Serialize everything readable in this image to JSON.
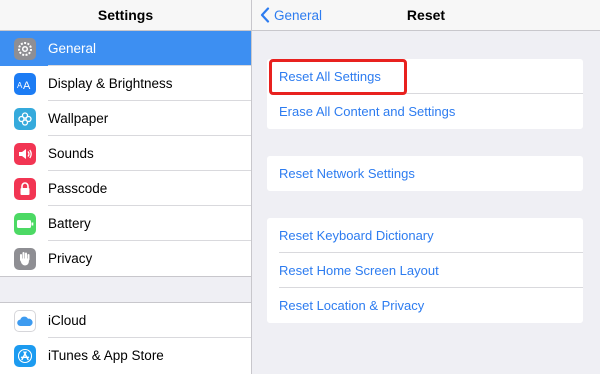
{
  "sidebar": {
    "title": "Settings",
    "items": [
      {
        "label": "General",
        "icon": "gear-icon",
        "color": "#8e8e93"
      },
      {
        "label": "Display & Brightness",
        "icon": "text-size-icon",
        "color": "#1c7cf4"
      },
      {
        "label": "Wallpaper",
        "icon": "flower-icon",
        "color": "#35aadc"
      },
      {
        "label": "Sounds",
        "icon": "speaker-icon",
        "color": "#f23553"
      },
      {
        "label": "Passcode",
        "icon": "lock-icon",
        "color": "#f23553"
      },
      {
        "label": "Battery",
        "icon": "battery-icon",
        "color": "#4cd964"
      },
      {
        "label": "Privacy",
        "icon": "hand-icon",
        "color": "#8e8e93"
      },
      {
        "label": "iCloud",
        "icon": "cloud-icon",
        "color": "#ffffff"
      },
      {
        "label": "iTunes & App Store",
        "icon": "app-store-icon",
        "color": "#1c9bf0"
      }
    ]
  },
  "detail": {
    "back_label": "General",
    "title": "Reset",
    "groups": [
      [
        "Reset All Settings",
        "Erase All Content and Settings"
      ],
      [
        "Reset Network Settings"
      ],
      [
        "Reset Keyboard Dictionary",
        "Reset Home Screen Layout",
        "Reset Location & Privacy"
      ]
    ]
  },
  "colors": {
    "accent": "#2d7cf0",
    "selected": "#3d8ff2",
    "highlight": "#e8211f"
  }
}
